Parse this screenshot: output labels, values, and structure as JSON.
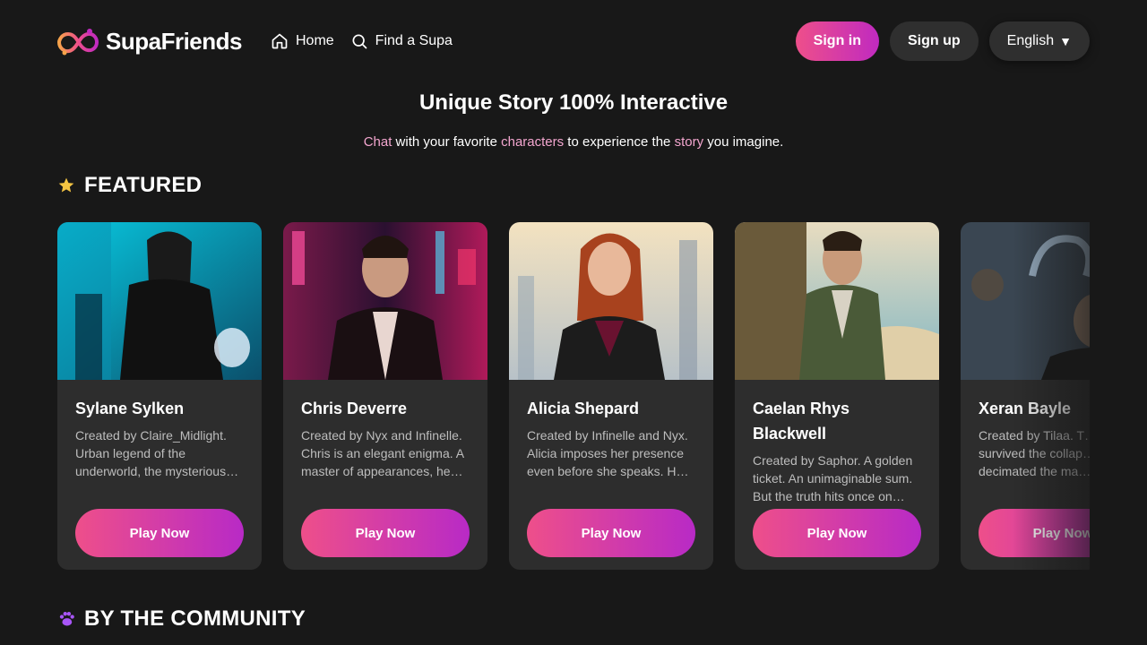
{
  "header": {
    "logo_text": "SupaFriends",
    "nav": [
      {
        "label": "Home",
        "icon": "home-icon"
      },
      {
        "label": "Find a Supa",
        "icon": "search-icon"
      }
    ],
    "signin_label": "Sign in",
    "signup_label": "Sign up",
    "language_label": "English",
    "language_caret": "▼"
  },
  "hero": {
    "title": "Unique Story 100% Interactive",
    "subtitle_parts": [
      "Chat",
      " with your favorite ",
      "characters",
      " to experience the ",
      "story",
      " you imagine."
    ]
  },
  "sections": {
    "featured": {
      "title": "FEATURED",
      "icon": "star-icon"
    },
    "community": {
      "title": "BY THE COMMUNITY",
      "icon": "paw-icon"
    }
  },
  "cards": [
    {
      "name": "Sylane Sylken",
      "description": "Created by Claire_Midlight. Urban legend of the underworld, the mysterious…",
      "button": "Play Now"
    },
    {
      "name": "Chris Deverre",
      "description": "Created by Nyx and Infinelle. Chris is an elegant enigma. A master of appearances, he…",
      "button": "Play Now"
    },
    {
      "name": "Alicia Shepard",
      "description": "Created by Infinelle and Nyx. Alicia imposes her presence even before she speaks. H…",
      "button": "Play Now"
    },
    {
      "name": "Caelan Rhys Blackwell",
      "description": "Created by Saphor. A golden ticket. An unimaginable sum. But the truth hits once on…",
      "button": "Play Now"
    },
    {
      "name": "Xeran Bayle",
      "description": "Created by Tilaa. T… survived the collap… decimated the ma…",
      "button": "Play Now"
    }
  ],
  "colors": {
    "background": "#181818",
    "card": "#2d2d2d",
    "gradient_start": "#ee4f8a",
    "gradient_end": "#c02ac0",
    "highlight": "#f3a6cf",
    "star": "#f5c542",
    "paw": "#a855f7"
  }
}
